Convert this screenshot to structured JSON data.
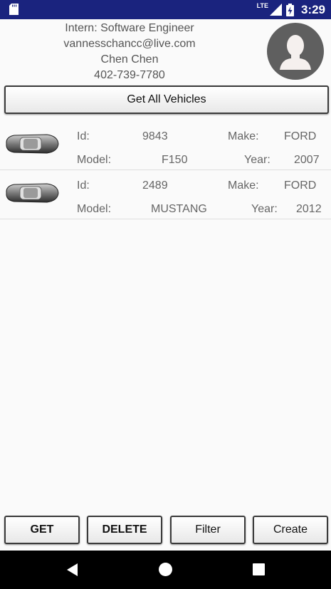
{
  "status_bar": {
    "network": "LTE",
    "time": "3:29",
    "icons": [
      "sd-card-icon",
      "signal-icon",
      "battery-charging-icon"
    ]
  },
  "header": {
    "title": "Intern: Software Engineer",
    "email": "vannesschancc@live.com",
    "name": "Chen Chen",
    "phone": "402-739-7780",
    "avatar_icon": "person-avatar-icon"
  },
  "actions": {
    "get_all_label": "Get All Vehicles"
  },
  "labels": {
    "id": "Id:",
    "make": "Make:",
    "model": "Model:",
    "year": "Year:"
  },
  "vehicles": [
    {
      "id": "9843",
      "make": "FORD",
      "model": "F150",
      "year": "2007",
      "icon": "car-icon"
    },
    {
      "id": "2489",
      "make": "FORD",
      "model": "MUSTANG",
      "year": "2012",
      "icon": "car-icon"
    }
  ],
  "bottom_buttons": {
    "get": "GET",
    "delete": "DELETE",
    "filter": "Filter",
    "create": "Create"
  },
  "nav": {
    "back": "back-icon",
    "home": "home-icon",
    "recents": "recents-icon"
  },
  "colors": {
    "status_bar": "#1a237e",
    "background": "#fafafa",
    "avatar_bg": "#5f5f5f",
    "nav_bar": "#000000"
  }
}
